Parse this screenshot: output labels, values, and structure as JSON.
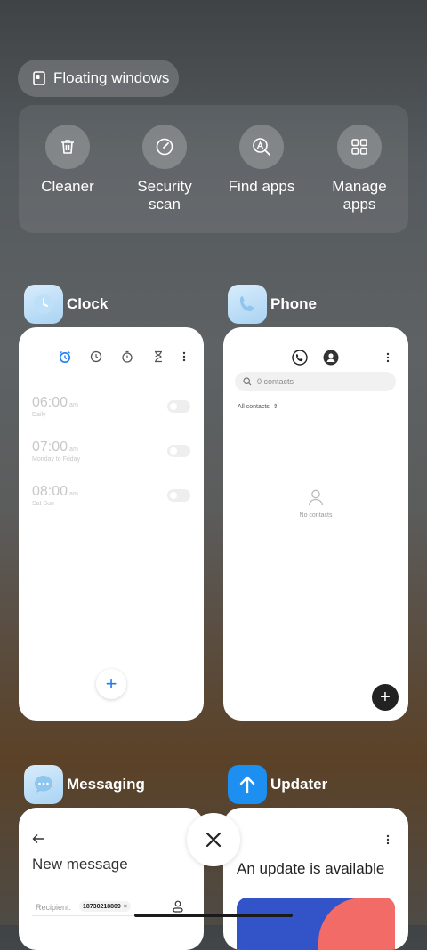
{
  "floating_windows": {
    "label": "Floating windows"
  },
  "quick_tools": [
    {
      "label": "Cleaner",
      "icon": "trash-icon"
    },
    {
      "label": "Security\nscan",
      "icon": "security-scan-icon"
    },
    {
      "label": "Find apps",
      "icon": "find-apps-icon"
    },
    {
      "label": "Manage\napps",
      "icon": "grid-icon"
    }
  ],
  "recent_apps": {
    "clock": {
      "name": "Clock",
      "alarms": [
        {
          "time": "06:00",
          "ampm": "am",
          "repeat": "Daily"
        },
        {
          "time": "07:00",
          "ampm": "am",
          "repeat": "Monday to Friday"
        },
        {
          "time": "08:00",
          "ampm": "am",
          "repeat": "Sat Sun"
        }
      ]
    },
    "phone": {
      "name": "Phone",
      "search_placeholder": "0 contacts",
      "filter": "All contacts",
      "empty_text": "No contacts"
    },
    "messaging": {
      "name": "Messaging",
      "title": "New message",
      "recipient_label": "Recipient:",
      "recipient_chip": "18730218809"
    },
    "updater": {
      "name": "Updater",
      "heading": "An update is available"
    }
  },
  "colors": {
    "clock_accent": "#1e7bf2",
    "updater_icon": "#1c8ff0",
    "banner_blue": "#3353c9",
    "banner_coral": "#f26b66"
  }
}
